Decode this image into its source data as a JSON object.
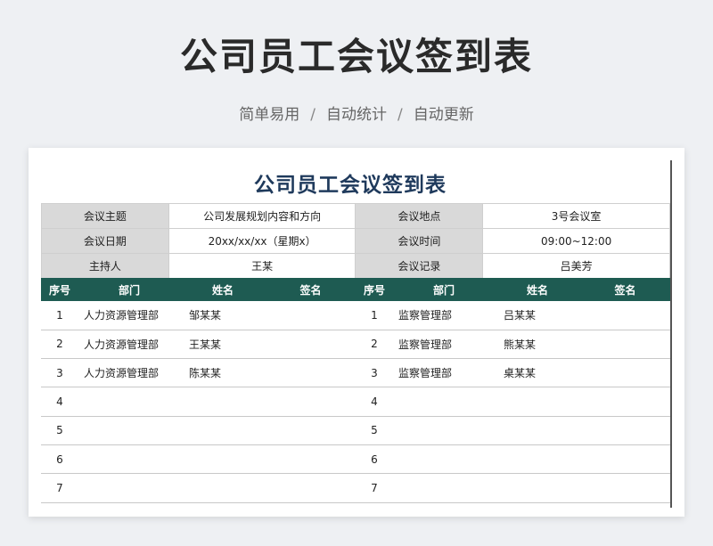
{
  "header": {
    "title": "公司员工会议签到表",
    "tags": [
      "简单易用",
      "自动统计",
      "自动更新"
    ],
    "separator": "/"
  },
  "sheet": {
    "title": "公司员工会议签到表",
    "info": {
      "topic_label": "会议主题",
      "topic_value": "公司发展规划内容和方向",
      "location_label": "会议地点",
      "location_value": "3号会议室",
      "date_label": "会议日期",
      "date_value": "20xx/xx/xx（星期x）",
      "time_label": "会议时间",
      "time_value": "09:00~12:00",
      "host_label": "主持人",
      "host_value": "王某",
      "recorder_label": "会议记录",
      "recorder_value": "吕美芳"
    },
    "columns": [
      "序号",
      "部门",
      "姓名",
      "签名",
      "序号",
      "部门",
      "姓名",
      "签名"
    ],
    "rows": [
      {
        "no_l": "1",
        "dept_l": "人力资源管理部",
        "name_l": "邹某某",
        "sign_l": "",
        "no_r": "1",
        "dept_r": "监察管理部",
        "name_r": "吕某某",
        "sign_r": ""
      },
      {
        "no_l": "2",
        "dept_l": "人力资源管理部",
        "name_l": "王某某",
        "sign_l": "",
        "no_r": "2",
        "dept_r": "监察管理部",
        "name_r": "熊某某",
        "sign_r": ""
      },
      {
        "no_l": "3",
        "dept_l": "人力资源管理部",
        "name_l": "陈某某",
        "sign_l": "",
        "no_r": "3",
        "dept_r": "监察管理部",
        "name_r": "桌某某",
        "sign_r": ""
      },
      {
        "no_l": "4",
        "dept_l": "",
        "name_l": "",
        "sign_l": "",
        "no_r": "4",
        "dept_r": "",
        "name_r": "",
        "sign_r": ""
      },
      {
        "no_l": "5",
        "dept_l": "",
        "name_l": "",
        "sign_l": "",
        "no_r": "5",
        "dept_r": "",
        "name_r": "",
        "sign_r": ""
      },
      {
        "no_l": "6",
        "dept_l": "",
        "name_l": "",
        "sign_l": "",
        "no_r": "6",
        "dept_r": "",
        "name_r": "",
        "sign_r": ""
      },
      {
        "no_l": "7",
        "dept_l": "",
        "name_l": "",
        "sign_l": "",
        "no_r": "7",
        "dept_r": "",
        "name_r": "",
        "sign_r": ""
      }
    ]
  },
  "colors": {
    "header_bg": "#1e5b52",
    "title_color": "#1f3a5c",
    "label_bg": "#d9d9d9"
  }
}
